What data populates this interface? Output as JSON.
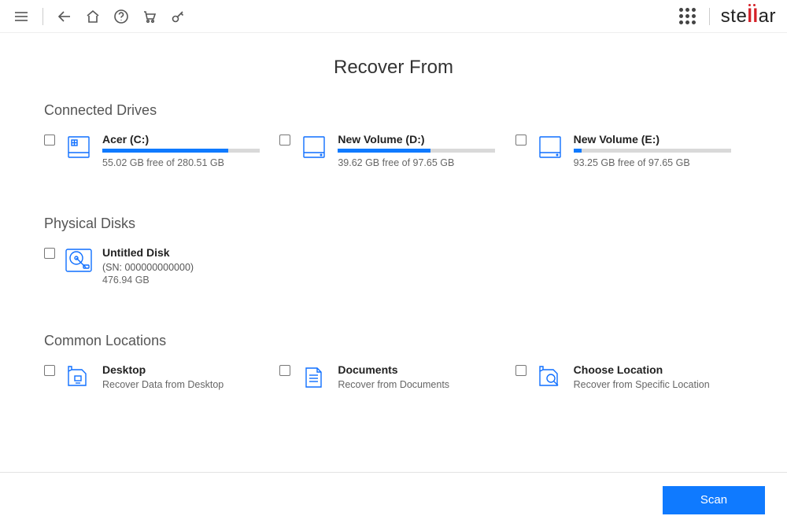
{
  "brand": {
    "name": "stellar"
  },
  "page_title": "Recover From",
  "sections": {
    "connected_drives": {
      "header": "Connected Drives",
      "items": [
        {
          "title": "Acer (C:)",
          "sub": "55.02 GB free of 280.51 GB",
          "used_pct": 80
        },
        {
          "title": "New Volume (D:)",
          "sub": "39.62 GB free of 97.65 GB",
          "used_pct": 59
        },
        {
          "title": "New Volume (E:)",
          "sub": "93.25 GB free of 97.65 GB",
          "used_pct": 5
        }
      ]
    },
    "physical_disks": {
      "header": "Physical Disks",
      "items": [
        {
          "title": "Untitled Disk",
          "serial": "(SN: 000000000000)",
          "size": "476.94 GB"
        }
      ]
    },
    "common_locations": {
      "header": "Common Locations",
      "items": [
        {
          "title": "Desktop",
          "sub": "Recover Data from Desktop"
        },
        {
          "title": "Documents",
          "sub": "Recover from Documents"
        },
        {
          "title": "Choose Location",
          "sub": "Recover from Specific Location"
        }
      ]
    }
  },
  "footer": {
    "scan_label": "Scan"
  }
}
